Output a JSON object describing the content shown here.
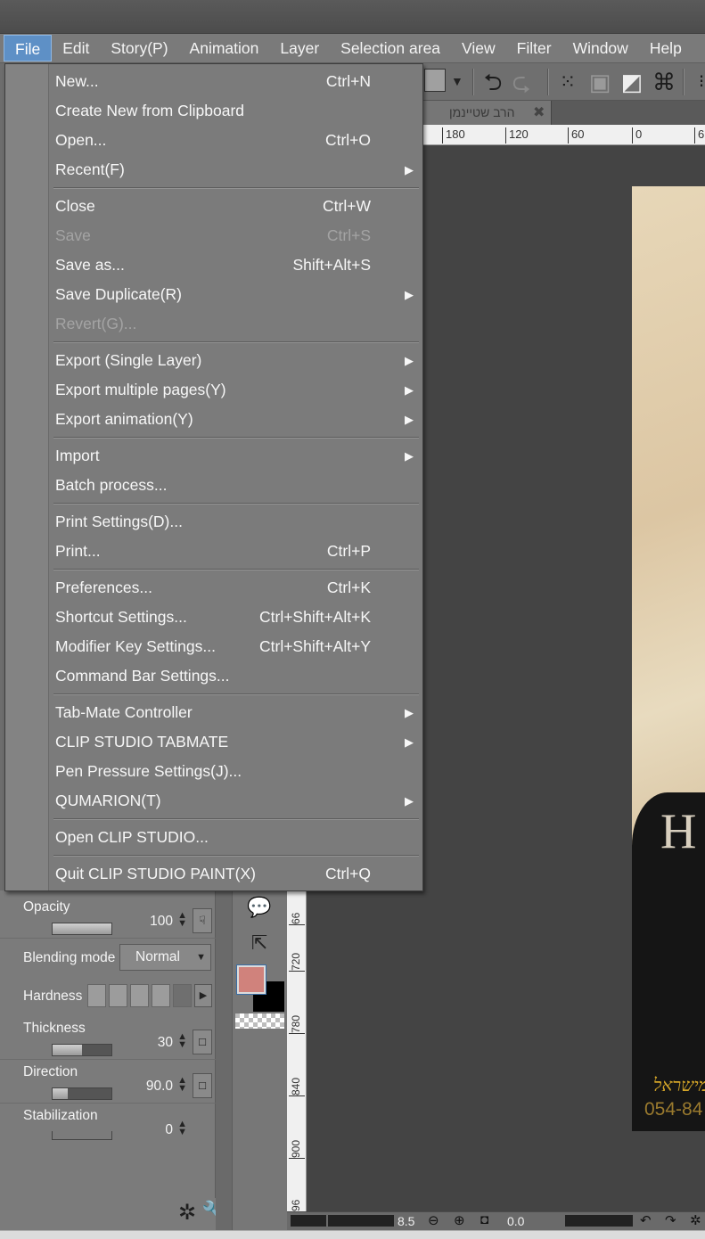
{
  "menubar": {
    "items": [
      "File",
      "Edit",
      "Story(P)",
      "Animation",
      "Layer",
      "Selection area",
      "View",
      "Filter",
      "Window",
      "Help"
    ]
  },
  "canvas": {
    "tab_title": "הרב שטיינמן",
    "ruler_h": [
      "180",
      "120",
      "60",
      "0",
      "6"
    ],
    "ruler_v": [
      "66",
      "720",
      "780",
      "840",
      "900",
      "96"
    ],
    "art_letter": "H",
    "art_gold_text": "ממישראל",
    "art_phone": "054-84",
    "zoom": "8.5",
    "angle": "0.0"
  },
  "file_menu": {
    "items": [
      {
        "label": "New...",
        "shortcut": "Ctrl+N",
        "submenu": false,
        "disabled": false
      },
      {
        "label": "Create New from Clipboard",
        "shortcut": "",
        "submenu": false,
        "disabled": false
      },
      {
        "label": "Open...",
        "shortcut": "Ctrl+O",
        "submenu": false,
        "disabled": false
      },
      {
        "label": "Recent(F)",
        "shortcut": "",
        "submenu": true,
        "disabled": false
      },
      {
        "label": "Close",
        "shortcut": "Ctrl+W",
        "submenu": false,
        "disabled": false
      },
      {
        "label": "Save",
        "shortcut": "Ctrl+S",
        "submenu": false,
        "disabled": true
      },
      {
        "label": "Save as...",
        "shortcut": "Shift+Alt+S",
        "submenu": false,
        "disabled": false
      },
      {
        "label": "Save Duplicate(R)",
        "shortcut": "",
        "submenu": true,
        "disabled": false
      },
      {
        "label": "Revert(G)...",
        "shortcut": "",
        "submenu": false,
        "disabled": true
      },
      {
        "label": "Export (Single Layer)",
        "shortcut": "",
        "submenu": true,
        "disabled": false
      },
      {
        "label": "Export multiple pages(Y)",
        "shortcut": "",
        "submenu": true,
        "disabled": false
      },
      {
        "label": "Export animation(Y)",
        "shortcut": "",
        "submenu": true,
        "disabled": false
      },
      {
        "label": "Import",
        "shortcut": "",
        "submenu": true,
        "disabled": false
      },
      {
        "label": "Batch process...",
        "shortcut": "",
        "submenu": false,
        "disabled": false
      },
      {
        "label": "Print Settings(D)...",
        "shortcut": "",
        "submenu": false,
        "disabled": false
      },
      {
        "label": "Print...",
        "shortcut": "Ctrl+P",
        "submenu": false,
        "disabled": false
      },
      {
        "label": "Preferences...",
        "shortcut": "Ctrl+K",
        "submenu": false,
        "disabled": false
      },
      {
        "label": "Shortcut Settings...",
        "shortcut": "Ctrl+Shift+Alt+K",
        "submenu": false,
        "disabled": false
      },
      {
        "label": "Modifier Key Settings...",
        "shortcut": "Ctrl+Shift+Alt+Y",
        "submenu": false,
        "disabled": false
      },
      {
        "label": "Command Bar Settings...",
        "shortcut": "",
        "submenu": false,
        "disabled": false
      },
      {
        "label": "Tab-Mate Controller",
        "shortcut": "",
        "submenu": true,
        "disabled": false
      },
      {
        "label": "CLIP STUDIO TABMATE",
        "shortcut": "",
        "submenu": true,
        "disabled": false
      },
      {
        "label": "Pen Pressure Settings(J)...",
        "shortcut": "",
        "submenu": false,
        "disabled": false
      },
      {
        "label": "QUMARION(T)",
        "shortcut": "",
        "submenu": true,
        "disabled": false
      },
      {
        "label": "Open CLIP STUDIO...",
        "shortcut": "",
        "submenu": false,
        "disabled": false
      },
      {
        "label": "Quit CLIP STUDIO PAINT(X)",
        "shortcut": "Ctrl+Q",
        "submenu": false,
        "disabled": false
      }
    ]
  },
  "tool_property": {
    "opacity": {
      "label": "Opacity",
      "value": "100",
      "level": 1.0
    },
    "blending": {
      "label": "Blending mode",
      "value": "Normal"
    },
    "hardness": {
      "label": "Hardness"
    },
    "thickness": {
      "label": "Thickness",
      "value": "30",
      "level": 0.5
    },
    "direction": {
      "label": "Direction",
      "value": "90.0",
      "level": 0.25
    },
    "stabilization": {
      "label": "Stabilization",
      "value": "0",
      "level": 0.0
    }
  },
  "colors": {
    "main_color": "#d0827c",
    "sub_color": "#000000",
    "menu_highlight": "#5e90c6"
  }
}
